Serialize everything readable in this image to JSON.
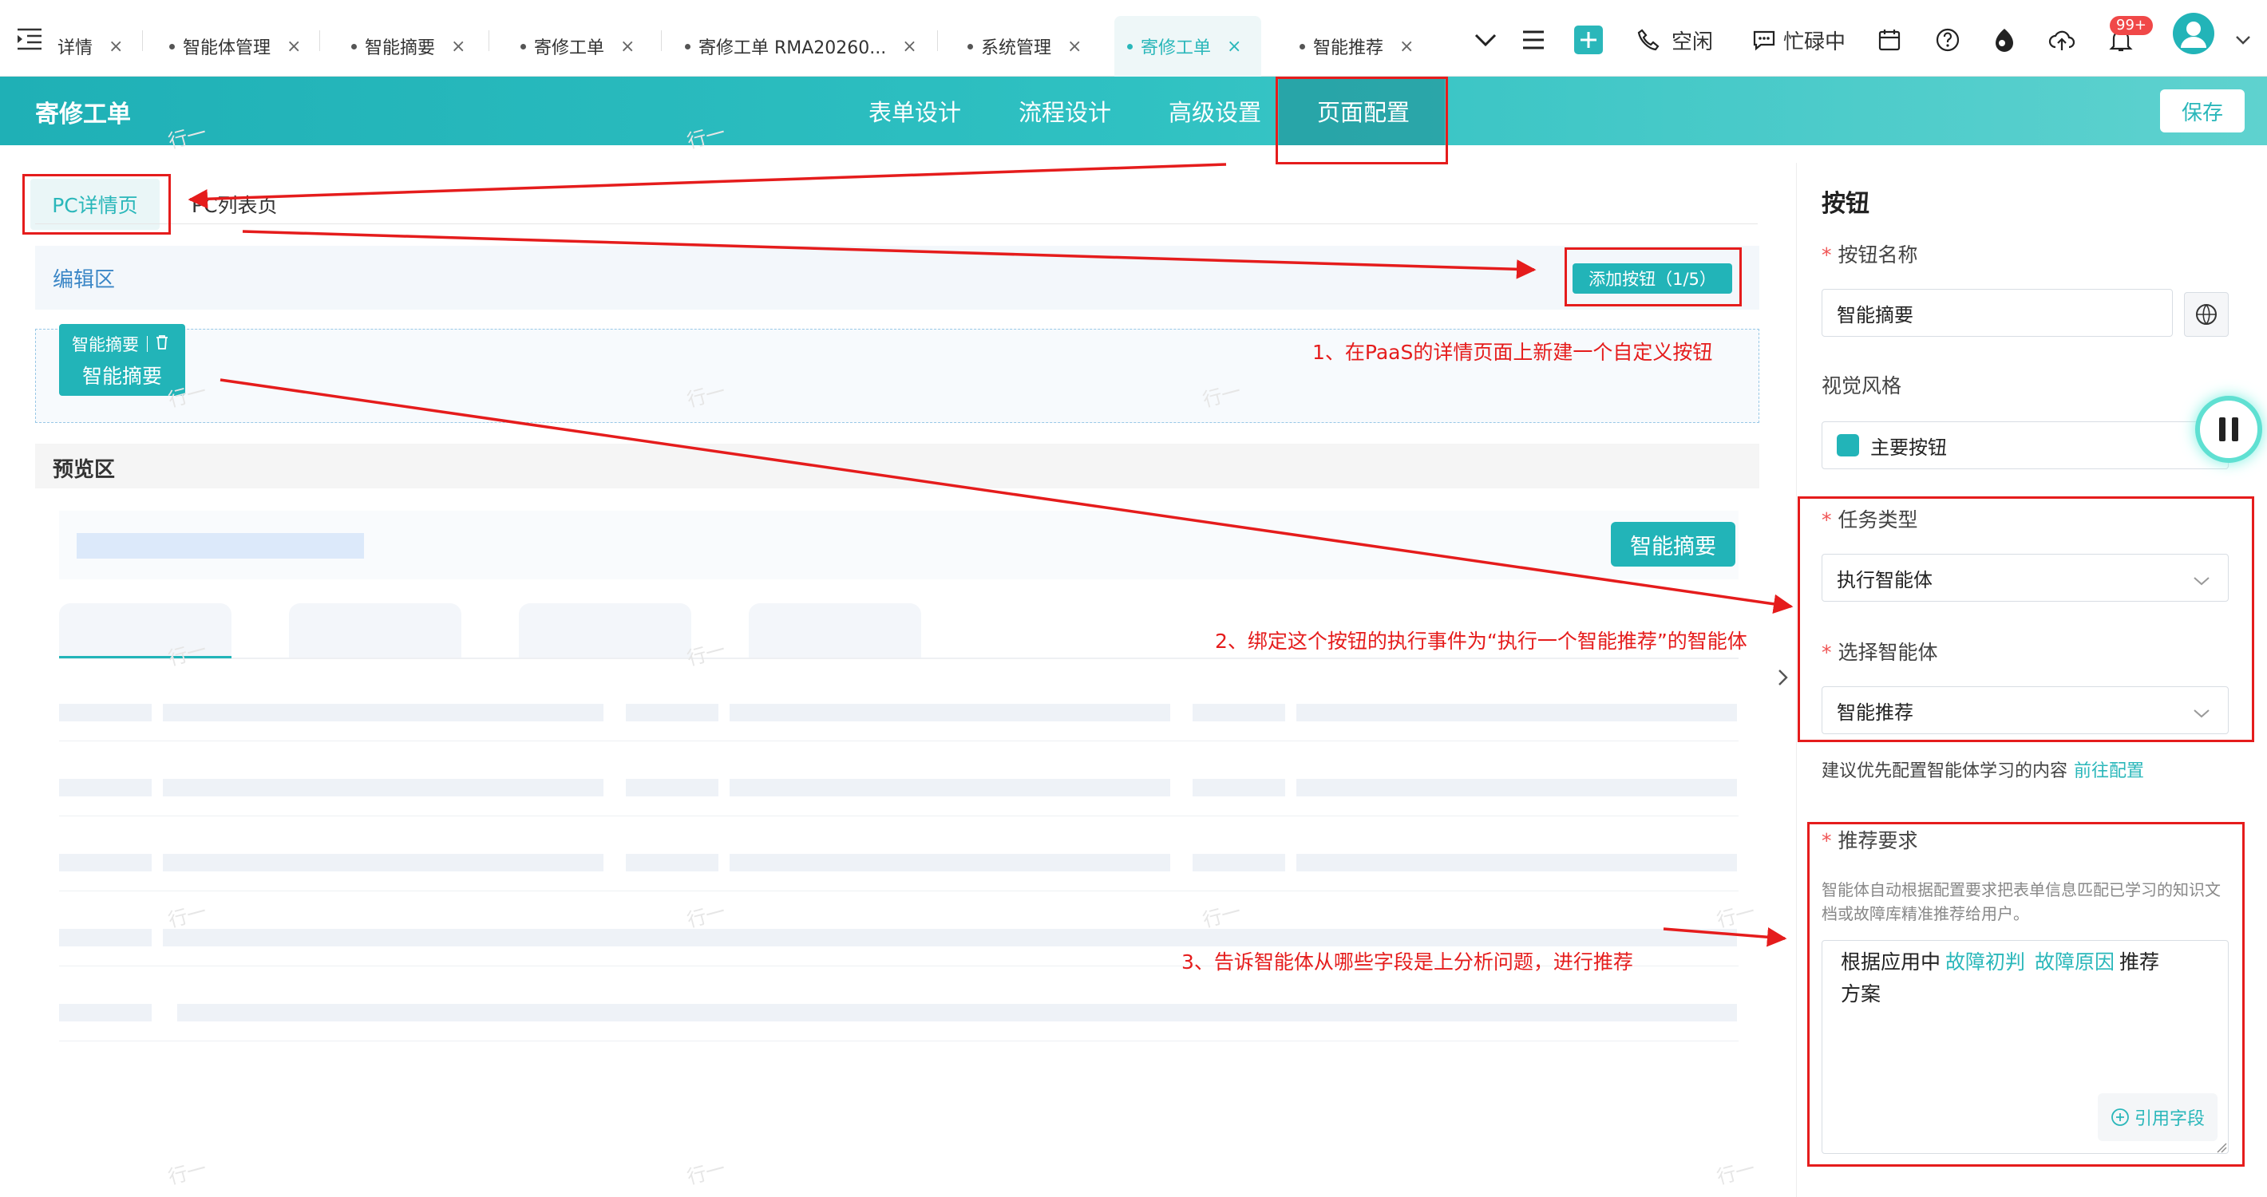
{
  "tabs": [
    {
      "label": "详情"
    },
    {
      "label": "智能体管理"
    },
    {
      "label": "智能摘要"
    },
    {
      "label": "寄修工单"
    },
    {
      "label": "寄修工单 RMA20260..."
    },
    {
      "label": "系统管理"
    },
    {
      "label": "寄修工单"
    },
    {
      "label": "智能推荐"
    }
  ],
  "tab_close": "×",
  "status": {
    "idle": "空闲",
    "busy": "忙碌中",
    "badge": "99+"
  },
  "header": {
    "title": "寄修工单",
    "tabs": [
      "表单设计",
      "流程设计",
      "高级设置",
      "页面配置"
    ],
    "save": "保存"
  },
  "sub_tabs": [
    "PC详情页",
    "PC列表页"
  ],
  "edit_area": {
    "label": "编辑区",
    "add_button": "添加按钮（1/5）",
    "chip_label": "智能摘要",
    "chip_button": "智能摘要"
  },
  "preview": {
    "label": "预览区",
    "button": "智能摘要"
  },
  "right_panel": {
    "title": "按钮",
    "name_label": "按钮名称",
    "name_value": "智能摘要",
    "style_label": "视觉风格",
    "style_value": "主要按钮",
    "task_label": "任务类型",
    "task_value": "执行智能体",
    "agent_label": "选择智能体",
    "agent_value": "智能推荐",
    "hint": "建议优先配置智能体学习的内容",
    "hint_link": "前往配置",
    "rec_label": "推荐要求",
    "rec_desc": "智能体自动根据配置要求把表单信息匹配已学习的知识文档或故障库精准推荐给用户。",
    "rec_text_1": "根据应用中",
    "rec_token_1": "故障初判",
    "rec_token_2": "故障原因",
    "rec_text_2": "推荐",
    "rec_text_3": "方案",
    "ref_field": "引用字段"
  },
  "annotations": [
    "1、在PaaS的详情页面上新建一个自定义按钮",
    "2、绑定这个按钮的执行事件为“执行一个智能推荐”的智能体",
    "3、告诉智能体从哪些字段是上分析问题，进行推荐"
  ],
  "watermark": "行一",
  "colors": {
    "brand": "#22b4b8",
    "annotation": "#e51c1c",
    "badge": "#f04848"
  }
}
